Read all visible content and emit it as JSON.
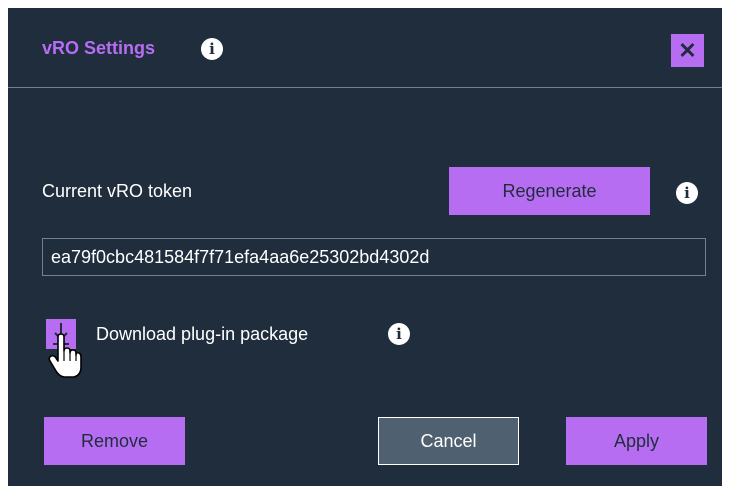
{
  "dialog": {
    "title": "vRO Settings",
    "close_label": "✕",
    "token_label": "Current vRO token",
    "regenerate_label": "Regenerate",
    "token_value": "ea79f0cbc481584f7f71efa4aa6e25302bd4302d",
    "download_label": "Download plug-in package",
    "remove_label": "Remove",
    "cancel_label": "Cancel",
    "apply_label": "Apply",
    "info_glyph": "i"
  },
  "colors": {
    "background": "#1f2d3d",
    "accent": "#b76df2",
    "cancel_bg": "#4f6170",
    "divider": "#6f8292",
    "text": "#ffffff"
  },
  "icons": {
    "info": "info-icon",
    "close": "close-icon",
    "download": "download-icon",
    "cursor": "hand-cursor-icon"
  }
}
